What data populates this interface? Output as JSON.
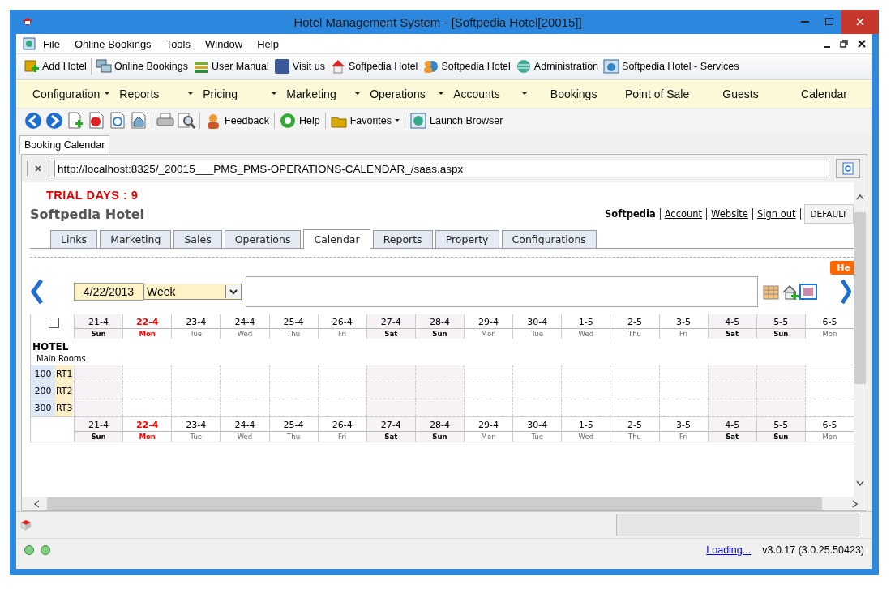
{
  "window": {
    "title": "Hotel Management System - [Softpedia Hotel[20015]]"
  },
  "menu": [
    {
      "label": "File"
    },
    {
      "label": "Online Bookings"
    },
    {
      "label": "Tools"
    },
    {
      "label": "Window"
    },
    {
      "label": "Help"
    }
  ],
  "toolbar": [
    {
      "label": "Add Hotel"
    },
    {
      "label": "Online Bookings"
    },
    {
      "label": "User Manual"
    },
    {
      "label": "Visit us"
    },
    {
      "label": "Softpedia Hotel"
    },
    {
      "label": "Softpedia Hotel"
    },
    {
      "label": "Administration"
    },
    {
      "label": "Softpedia Hotel - Services"
    }
  ],
  "nav": [
    {
      "label": "Configuration",
      "dropdown": true
    },
    {
      "label": "Reports",
      "dropdown": true
    },
    {
      "label": "Pricing",
      "dropdown": true
    },
    {
      "label": "Marketing",
      "dropdown": true
    },
    {
      "label": "Operations",
      "dropdown": true
    },
    {
      "label": "Accounts",
      "dropdown": true
    },
    {
      "label": "Bookings",
      "dropdown": false
    },
    {
      "label": "Point of Sale",
      "dropdown": false
    },
    {
      "label": "Guests",
      "dropdown": false
    },
    {
      "label": "Calendar",
      "dropdown": false
    }
  ],
  "toolbar2": [
    {
      "label": "Feedback",
      "dropdown": false
    },
    {
      "label": "Help",
      "dropdown": false
    },
    {
      "label": "Favorites",
      "dropdown": true
    },
    {
      "label": "Launch Browser",
      "dropdown": false
    }
  ],
  "doc_tabs": [
    {
      "label": "Booking Calendar",
      "selected": true
    }
  ],
  "address": {
    "value": "http://localhost:8325/_20015___PMS_PMS-OPERATIONS-CALENDAR_/saas.aspx"
  },
  "page": {
    "trial": "TRIAL DAYS : 9",
    "hotel_name": "Softpedia Hotel",
    "user": "Softpedia",
    "links": [
      "Account",
      "Website",
      "Sign out"
    ],
    "theme_button": "DEFAULT",
    "help_badge": "He",
    "tabs": [
      {
        "label": "Links",
        "selected": false
      },
      {
        "label": "Marketing",
        "selected": false
      },
      {
        "label": "Sales",
        "selected": false
      },
      {
        "label": "Operations",
        "selected": false
      },
      {
        "label": "Calendar",
        "selected": true
      },
      {
        "label": "Reports",
        "selected": false
      },
      {
        "label": "Property",
        "selected": false
      },
      {
        "label": "Configurations",
        "selected": false
      }
    ]
  },
  "calendar": {
    "date": "4/22/2013",
    "view": "Week",
    "select_all": false,
    "group": "HOTEL",
    "subgroup": "Main Rooms",
    "days_top": [
      {
        "date": "21-4",
        "day": "Sun",
        "weekend": true,
        "today": false
      },
      {
        "date": "22-4",
        "day": "Mon",
        "weekend": false,
        "today": true
      },
      {
        "date": "23-4",
        "day": "Tue",
        "weekend": false,
        "today": false
      },
      {
        "date": "24-4",
        "day": "Wed",
        "weekend": false,
        "today": false
      },
      {
        "date": "25-4",
        "day": "Thu",
        "weekend": false,
        "today": false
      },
      {
        "date": "26-4",
        "day": "Fri",
        "weekend": false,
        "today": false
      },
      {
        "date": "27-4",
        "day": "Sat",
        "weekend": true,
        "today": false
      },
      {
        "date": "28-4",
        "day": "Sun",
        "weekend": true,
        "today": false
      },
      {
        "date": "29-4",
        "day": "Mon",
        "weekend": false,
        "today": false
      },
      {
        "date": "30-4",
        "day": "Tue",
        "weekend": false,
        "today": false
      },
      {
        "date": "1-5",
        "day": "Wed",
        "weekend": false,
        "today": false
      },
      {
        "date": "2-5",
        "day": "Thu",
        "weekend": false,
        "today": false
      },
      {
        "date": "3-5",
        "day": "Fri",
        "weekend": false,
        "today": false
      },
      {
        "date": "4-5",
        "day": "Sat",
        "weekend": true,
        "today": false
      },
      {
        "date": "5-5",
        "day": "Sun",
        "weekend": true,
        "today": false
      },
      {
        "date": "6-5",
        "day": "Mon",
        "weekend": false,
        "today": false
      }
    ],
    "rooms": [
      {
        "number": "100",
        "type": "RT1"
      },
      {
        "number": "200",
        "type": "RT2"
      },
      {
        "number": "300",
        "type": "RT3"
      }
    ],
    "days_bottom": [
      {
        "date": "21-4",
        "day": "Sun",
        "weekend": true,
        "today": false
      },
      {
        "date": "22-4",
        "day": "Mon",
        "weekend": false,
        "today": true
      },
      {
        "date": "23-4",
        "day": "Tue",
        "weekend": false,
        "today": false
      },
      {
        "date": "24-4",
        "day": "Wed",
        "weekend": false,
        "today": false
      },
      {
        "date": "25-4",
        "day": "Thu",
        "weekend": false,
        "today": false
      },
      {
        "date": "26-4",
        "day": "Fri",
        "weekend": false,
        "today": false
      },
      {
        "date": "27-4",
        "day": "Sat",
        "weekend": true,
        "today": false
      },
      {
        "date": "28-4",
        "day": "Sun",
        "weekend": true,
        "today": false
      },
      {
        "date": "29-4",
        "day": "Mon",
        "weekend": false,
        "today": false
      },
      {
        "date": "30-4",
        "day": "Tue",
        "weekend": false,
        "today": false
      },
      {
        "date": "1-5",
        "day": "Wed",
        "weekend": false,
        "today": false
      },
      {
        "date": "2-5",
        "day": "Thu",
        "weekend": false,
        "today": false
      },
      {
        "date": "3-5",
        "day": "Fri",
        "weekend": false,
        "today": false
      },
      {
        "date": "4-5",
        "day": "Sat",
        "weekend": true,
        "today": false
      },
      {
        "date": "5-5",
        "day": "Sun",
        "weekend": true,
        "today": false
      },
      {
        "date": "6-5",
        "day": "Mon",
        "weekend": false,
        "today": false
      }
    ]
  },
  "status_bar": {
    "loading": "Loading...",
    "version": "v3.0.17 (3.0.25.50423)"
  }
}
